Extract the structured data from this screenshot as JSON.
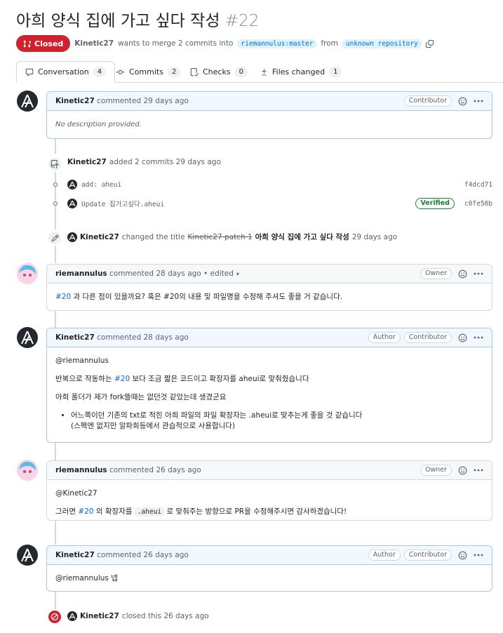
{
  "pr": {
    "title": "아희 양식 집에 가고 싶다 작성",
    "number": "#22",
    "state": "Closed",
    "author": "Kinetic27",
    "merge_text": "wants to merge 2 commits into",
    "base_branch": "riemannulus:master",
    "from_text": "from",
    "head_branch": "unknown repository"
  },
  "tabs": [
    {
      "label": "Conversation",
      "count": "4"
    },
    {
      "label": "Commits",
      "count": "2"
    },
    {
      "label": "Checks",
      "count": "0"
    },
    {
      "label": "Files changed",
      "count": "1"
    }
  ],
  "comment1": {
    "author": "Kinetic27",
    "meta": "commented 29 days ago",
    "badge": "Contributor",
    "body": "No description provided."
  },
  "commits_event": {
    "author": "Kinetic27",
    "text": "added 2 commits 29 days ago",
    "commits": [
      {
        "message": "add: aheui",
        "sha": "f4dcd71",
        "verified": ""
      },
      {
        "message": "Update 집가고싶다.aheui",
        "sha": "c0fe50b",
        "verified": "Verified"
      }
    ]
  },
  "rename_event": {
    "author": "Kinetic27",
    "text": "changed the title",
    "old_title": "Kinetic27 patch 1",
    "new_title": "아희 양식 집에 가고 싶다 작성",
    "time": "29 days ago"
  },
  "comment2": {
    "author": "riemannulus",
    "meta": "commented 28 days ago • edited",
    "badge": "Owner",
    "body_link": "#20",
    "body_text": " 과 다른 점이 있을까요? 혹은 #20의 내용 및 파일명을 수정해 주셔도 좋을 거 같습니다."
  },
  "comment3": {
    "author": "Kinetic27",
    "meta": "commented 28 days ago",
    "badge_author": "Author",
    "badge_contrib": "Contributor",
    "p1": "@riemannulus",
    "p2_pre": "반복으로 작동하는 ",
    "p2_link": "#20",
    "p2_post": " 보다 조금 짧은 코드이고 확장자를 aheui로 맞춰줬습니다",
    "p3": "아희 폴더가 제가 fork뜰때는 없던것 같았는데 생겼군요",
    "li_line1": "어느쪽이던 기존의 txt로 적힌 아희 파일의 파일 확장자는 .aheui로 맞추는게 좋을 것 같습니다",
    "li_line2": "(스펙엔 없지만 알파희등에서 관습적으로 사용합니다)"
  },
  "comment4": {
    "author": "riemannulus",
    "meta": "commented 26 days ago",
    "badge": "Owner",
    "p1": "@Kinetic27",
    "p2_pre": "그러면 ",
    "p2_link": "#20",
    "p2_mid": " 의 확장자를 ",
    "p2_code": ".aheui",
    "p2_post": " 로 맞춰주는 방향으로 PR을 수정해주시면 감사하겠습니다!"
  },
  "comment5": {
    "author": "Kinetic27",
    "meta": "commented 26 days ago",
    "badge_author": "Author",
    "badge_contrib": "Contributor",
    "body": "@riemannulus 넵"
  },
  "closed_event": {
    "author": "Kinetic27",
    "text": "closed this 26 days ago"
  },
  "colors": {
    "closed": "#cf222e",
    "link": "#0969da",
    "verified": "#1a7f37",
    "border_highlight": "#aac7e3"
  }
}
